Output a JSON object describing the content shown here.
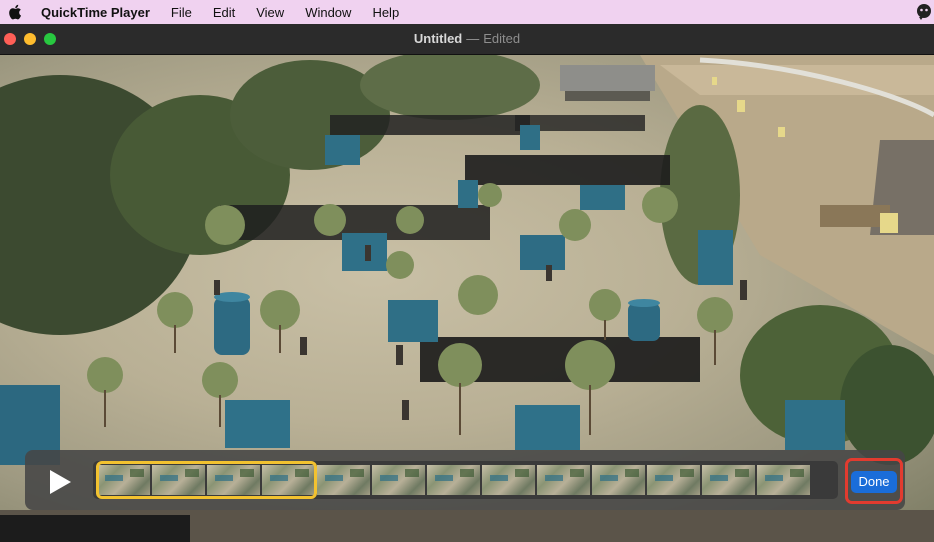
{
  "menubar": {
    "app_name": "QuickTime Player",
    "items": [
      "File",
      "Edit",
      "View",
      "Window",
      "Help"
    ]
  },
  "window": {
    "title": "Untitled",
    "separator": "—",
    "status": "Edited"
  },
  "trim": {
    "done_label": "Done",
    "thumbnail_count": 13
  },
  "colors": {
    "menubar_bg": "#f0d2f0",
    "trim_handle": "#f2c230",
    "done_button": "#1a6dd9",
    "highlight": "#e23b2f"
  },
  "icons": {
    "apple": "apple-logo-icon",
    "play": "play-icon",
    "status_right": "assistant-icon"
  }
}
